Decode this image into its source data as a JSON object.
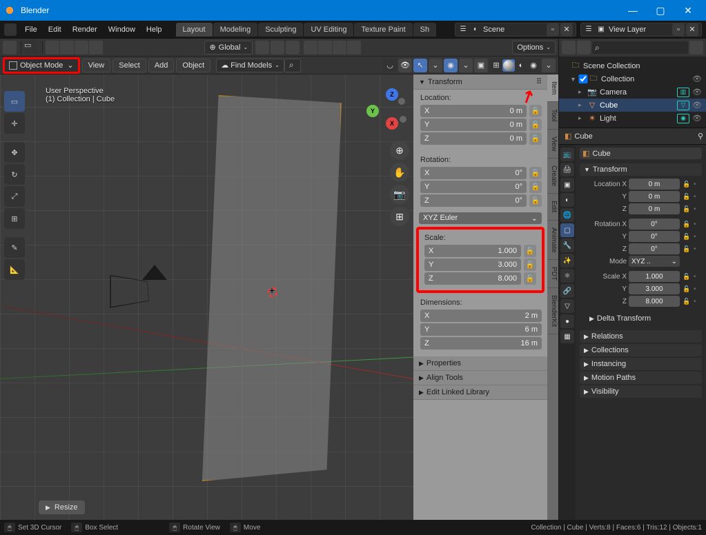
{
  "app": {
    "title": "Blender"
  },
  "menu": {
    "file": "File",
    "edit": "Edit",
    "render": "Render",
    "window": "Window",
    "help": "Help"
  },
  "workspace_tabs": [
    "Layout",
    "Modeling",
    "Sculpting",
    "UV Editing",
    "Texture Paint",
    "Sh"
  ],
  "workspace_active": 0,
  "scene": {
    "label": "Scene"
  },
  "view_layer": {
    "label": "View Layer"
  },
  "header1": {
    "global": "Global",
    "options": "Options"
  },
  "header2": {
    "mode": "Object Mode",
    "btns": {
      "view": "View",
      "select": "Select",
      "add": "Add",
      "object": "Object"
    },
    "find": "Find Models"
  },
  "overlay": {
    "line1": "User Perspective",
    "line2": "(1) Collection | Cube"
  },
  "n_panel": {
    "title": "Transform",
    "location": {
      "label": "Location:",
      "x": "0 m",
      "y": "0 m",
      "z": "0 m"
    },
    "rotation": {
      "label": "Rotation:",
      "x": "0°",
      "y": "0°",
      "z": "0°",
      "mode": "XYZ Euler"
    },
    "scale": {
      "label": "Scale:",
      "x": "1.000",
      "y": "3.000",
      "z": "8.000"
    },
    "dimensions": {
      "label": "Dimensions:",
      "x": "2 m",
      "y": "6 m",
      "z": "16 m"
    },
    "sections": [
      "Properties",
      "Align Tools",
      "Edit Linked Library"
    ]
  },
  "n_tabs": [
    "Item",
    "Tool",
    "View",
    "Create",
    "Edit",
    "Animate",
    "PDT",
    "BlenderKit"
  ],
  "n_tab_active": 0,
  "resize_box": "Resize",
  "outliner": {
    "root": "Scene Collection",
    "collection": "Collection",
    "items": [
      {
        "name": "Camera",
        "color": "#2bcdbd"
      },
      {
        "name": "Cube",
        "color": "#ff9955",
        "selected": true
      },
      {
        "name": "Light",
        "color": "#2bcdbd"
      }
    ]
  },
  "properties": {
    "breadcrumb": "Cube",
    "name": "Cube",
    "transform": {
      "title": "Transform",
      "loc": {
        "x": "0 m",
        "y": "0 m",
        "z": "0 m"
      },
      "rot": {
        "x": "0°",
        "y": "0°",
        "z": "0°"
      },
      "mode_dd": "XYZ .. ",
      "scale": {
        "x": "1.000",
        "y": "3.000",
        "z": "8.000"
      },
      "mode_label": "Mode",
      "loc_label": "Location X",
      "rot_label": "Rotation X",
      "scale_label": "Scale X",
      "delta": "Delta Transform"
    },
    "sections": [
      "Relations",
      "Collections",
      "Instancing",
      "Motion Paths",
      "Visibility"
    ]
  },
  "statusbar": {
    "left": [
      {
        "icon": "🖱",
        "text": "Set 3D Cursor"
      },
      {
        "icon": "⬚",
        "text": "Box Select"
      },
      {
        "icon": "↻",
        "text": "Rotate View"
      },
      {
        "icon": "✥",
        "text": "Move"
      }
    ],
    "right": "Collection | Cube | Verts:8 | Faces:6 | Tris:12 | Objects:1"
  }
}
